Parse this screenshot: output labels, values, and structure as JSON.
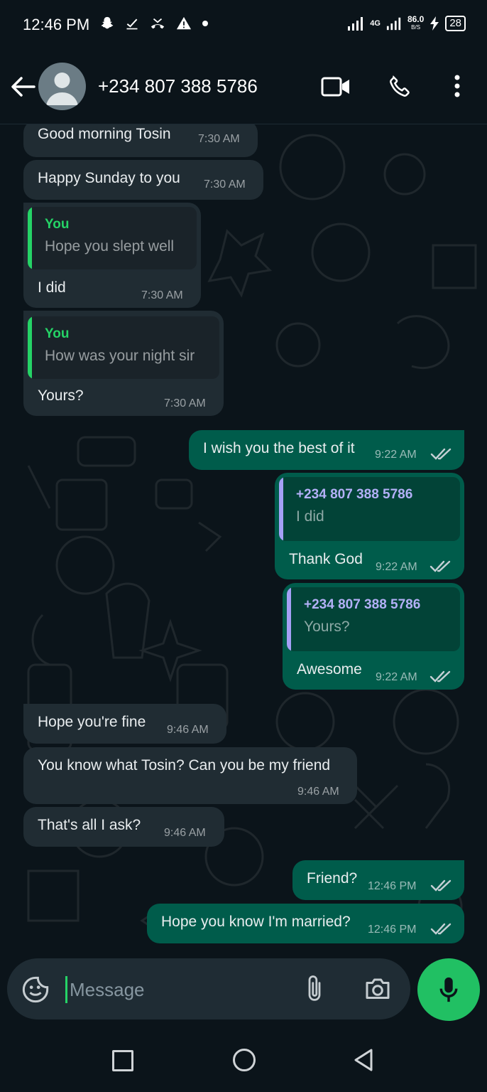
{
  "status_bar": {
    "time": "12:46 PM",
    "network": "4G",
    "speed_value": "86.0",
    "speed_unit": "B/S",
    "battery": "28",
    "icons": [
      "snapchat-icon",
      "check-icon",
      "missed-call-icon",
      "warning-icon",
      "dot-icon",
      "signal-icon",
      "signal-4g-icon",
      "charging-icon",
      "battery-icon"
    ]
  },
  "header": {
    "title": "+234 807 388 5786",
    "icons": [
      "back-arrow-icon",
      "avatar-icon",
      "video-call-icon",
      "phone-icon",
      "more-vert-icon"
    ]
  },
  "messages": [
    {
      "dir": "in",
      "text": "Good morning Tosin",
      "time": "7:30 AM"
    },
    {
      "dir": "in",
      "text": "Happy Sunday to you",
      "time": "7:30 AM"
    },
    {
      "dir": "in",
      "quote_name": "You",
      "quote_text": "Hope you slept well",
      "text": "I did",
      "time": "7:30 AM"
    },
    {
      "dir": "in",
      "quote_name": "You",
      "quote_text": "How was your night sir",
      "text": "Yours?",
      "time": "7:30 AM"
    },
    {
      "dir": "out",
      "text": "I wish you the best of it",
      "time": "9:22 AM",
      "read": true
    },
    {
      "dir": "out",
      "quote_name": "+234 807 388 5786",
      "quote_text": "I did",
      "text": "Thank God",
      "time": "9:22 AM",
      "read": true
    },
    {
      "dir": "out",
      "quote_name": "+234 807 388 5786",
      "quote_text": "Yours?",
      "text": "Awesome",
      "time": "9:22 AM",
      "read": true
    },
    {
      "dir": "in",
      "text": "Hope you're fine",
      "time": "9:46 AM"
    },
    {
      "dir": "in",
      "text": "You know what Tosin? Can you be my friend",
      "time": "9:46 AM"
    },
    {
      "dir": "in",
      "text": "That's all I ask?",
      "time": "9:46 AM"
    },
    {
      "dir": "out",
      "text": "Friend?",
      "time": "12:46 PM",
      "read": true
    },
    {
      "dir": "out",
      "text": "Hope you know I'm married?",
      "time": "12:46 PM",
      "read": true
    }
  ],
  "composer": {
    "placeholder": "Message",
    "value": "",
    "icons": [
      "sticker-icon",
      "paperclip-icon",
      "camera-icon",
      "mic-icon"
    ]
  },
  "colors": {
    "background": "#0b141a",
    "incoming_bubble": "#202c33",
    "outgoing_bubble": "#005c4b",
    "accent_green": "#21c063",
    "quote_you": "#25d366",
    "quote_contact": "#a5a0f5"
  },
  "nav_bar": {
    "icons": [
      "recent-apps-icon",
      "home-icon",
      "back-icon"
    ]
  }
}
